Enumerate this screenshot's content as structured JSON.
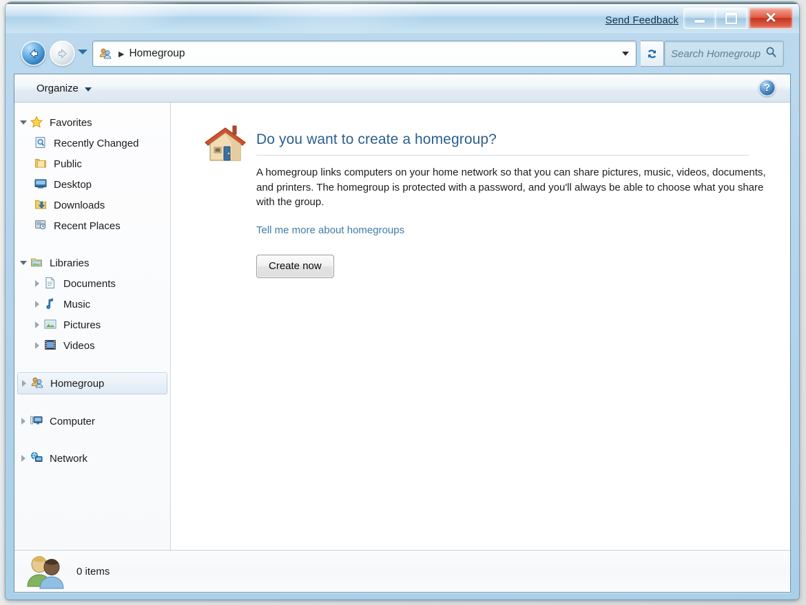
{
  "window": {
    "send_feedback": "Send Feedback",
    "caption": {
      "minimize": "Minimize",
      "maximize": "Maximize",
      "close": "Close",
      "close_glyph": "✕"
    }
  },
  "addressbar": {
    "icon": "homegroup-icon",
    "separator": "▶",
    "crumb": "Homegroup",
    "dropdown": "chevron-down-icon",
    "refresh": "refresh-icon"
  },
  "search": {
    "placeholder": "Search Homegroup",
    "icon": "search-icon"
  },
  "toolbar": {
    "organize_label": "Organize",
    "help_glyph": "?"
  },
  "navpane": {
    "groups": [
      {
        "label": "Favorites",
        "icon": "star-icon",
        "expanded": true,
        "items": [
          {
            "label": "Recently Changed",
            "icon": "recently-changed-icon"
          },
          {
            "label": "Public",
            "icon": "public-folder-icon"
          },
          {
            "label": "Desktop",
            "icon": "desktop-icon"
          },
          {
            "label": "Downloads",
            "icon": "downloads-icon"
          },
          {
            "label": "Recent Places",
            "icon": "recent-places-icon"
          }
        ]
      },
      {
        "label": "Libraries",
        "icon": "libraries-icon",
        "expanded": true,
        "items": [
          {
            "label": "Documents",
            "icon": "documents-icon"
          },
          {
            "label": "Music",
            "icon": "music-icon"
          },
          {
            "label": "Pictures",
            "icon": "pictures-icon"
          },
          {
            "label": "Videos",
            "icon": "videos-icon"
          }
        ]
      }
    ],
    "roots": [
      {
        "label": "Homegroup",
        "icon": "homegroup-icon",
        "selected": true
      },
      {
        "label": "Computer",
        "icon": "computer-icon",
        "selected": false
      },
      {
        "label": "Network",
        "icon": "network-icon",
        "selected": false
      }
    ]
  },
  "content": {
    "icon": "house-icon",
    "heading": "Do you want to create a homegroup?",
    "description": "A homegroup links computers on your home network so that you can share pictures, music, videos, documents, and printers. The homegroup is protected with a password, and you'll always be able to choose what you share with the group.",
    "link": "Tell me more about homegroups",
    "button": "Create now"
  },
  "statusbar": {
    "icon": "homegroup-people-icon",
    "text": "0 items"
  },
  "colors": {
    "heading": "#2b5f8e",
    "link": "#3f7ca8",
    "close_button": "#c5331e",
    "selection": "#dfeaf4",
    "frame": "#6a93a8"
  }
}
